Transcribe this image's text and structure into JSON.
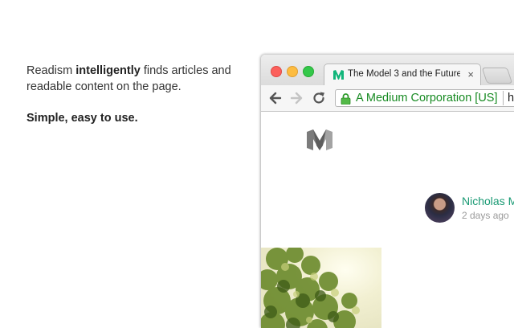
{
  "promo": {
    "line1_pre": "Readism ",
    "line1_bold": "intelligently",
    "line1_post": " finds articles and readable content on the page.",
    "line2": "Simple, easy to use."
  },
  "browser": {
    "tab": {
      "title": "The Model 3 and the Future",
      "close": "×",
      "favicon": "medium-m-icon"
    },
    "omnibox": {
      "ev_label": "A Medium Corporation [US]",
      "url_fragment": "h"
    },
    "icons": {
      "back": "back-arrow-icon",
      "forward": "forward-arrow-icon",
      "reload": "reload-icon",
      "lock": "lock-icon"
    }
  },
  "article": {
    "author": "Nicholas M",
    "posted": "2 days ago"
  },
  "colors": {
    "accent": "#1a9a74",
    "ev_green": "#168a21"
  }
}
